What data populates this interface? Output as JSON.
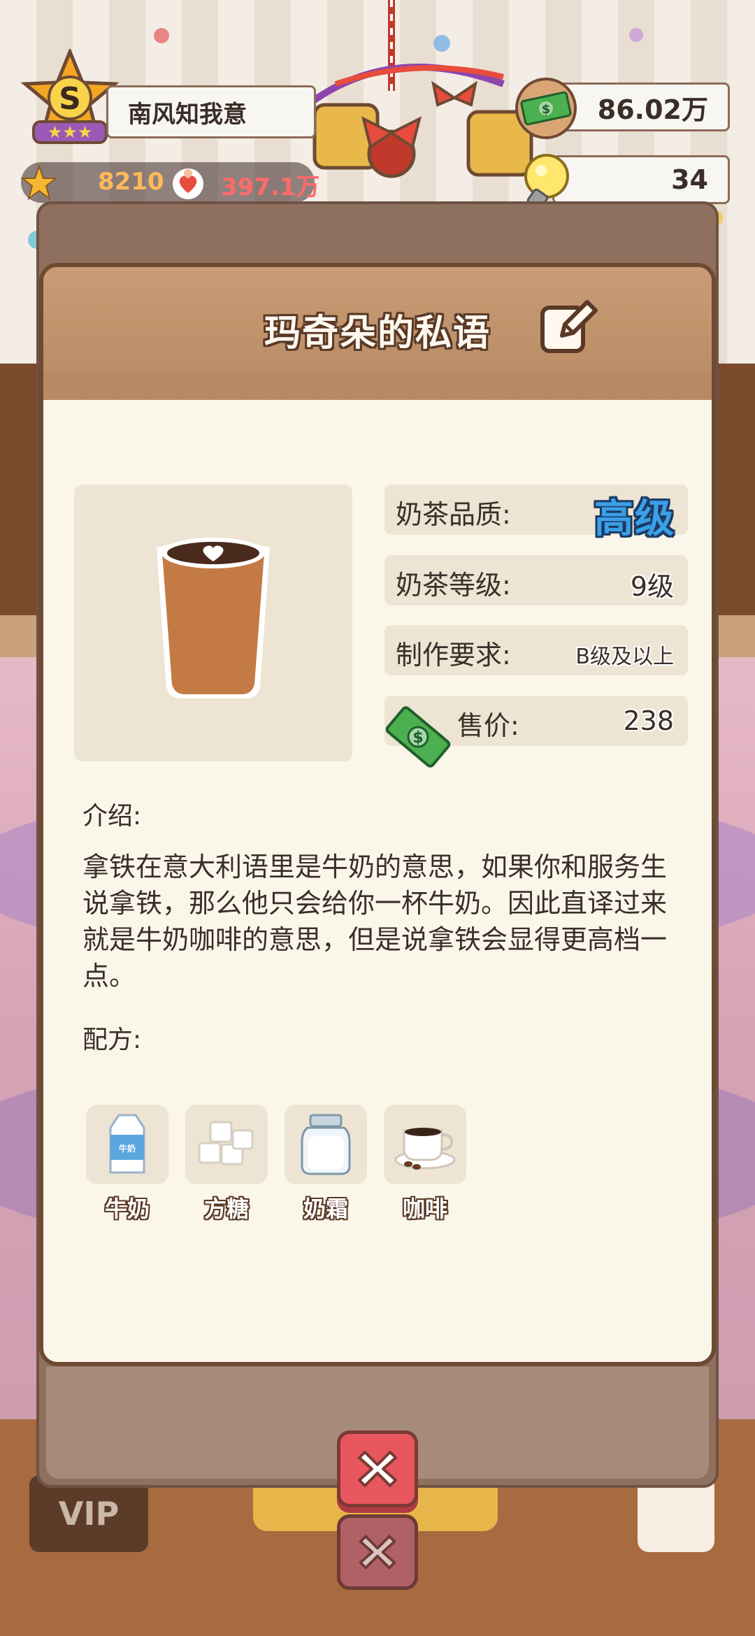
{
  "player": {
    "rank_letter": "S",
    "name": "南风知我意",
    "stars_count": "8210",
    "fans_count": "397.1万"
  },
  "resources": {
    "money": "86.02万",
    "ideas": "34"
  },
  "dialog": {
    "title": "玛奇朵的私语",
    "info": {
      "quality_label": "奶茶品质:",
      "quality_value": "高级",
      "level_label": "奶茶等级:",
      "level_value": "9级",
      "requirement_label": "制作要求:",
      "requirement_value": "B级及以上",
      "price_label": "售价:",
      "price_value": "238"
    },
    "intro_label": "介绍:",
    "description": "拿铁在意大利语里是牛奶的意思，如果你和服务生说拿铁，那么他只会给你一杯牛奶。因此直译过来就是牛奶咖啡的意思，但是说拿铁会显得更高档一点。",
    "recipe_label": "配方:",
    "ingredients": [
      {
        "name": "牛奶",
        "icon": "milk-carton-icon",
        "carton_text": "牛奶"
      },
      {
        "name": "方糖",
        "icon": "sugar-cubes-icon"
      },
      {
        "name": "奶霜",
        "icon": "cream-jar-icon"
      },
      {
        "name": "咖啡",
        "icon": "coffee-cup-icon"
      }
    ]
  },
  "background": {
    "vip_label": "VIP"
  },
  "colors": {
    "dialog_bg": "#fbf6ea",
    "header_brown": "#c89c74",
    "quality_blue": "#3aa0e8",
    "close_red": "#e8565e",
    "money_green": "#4caf50"
  }
}
